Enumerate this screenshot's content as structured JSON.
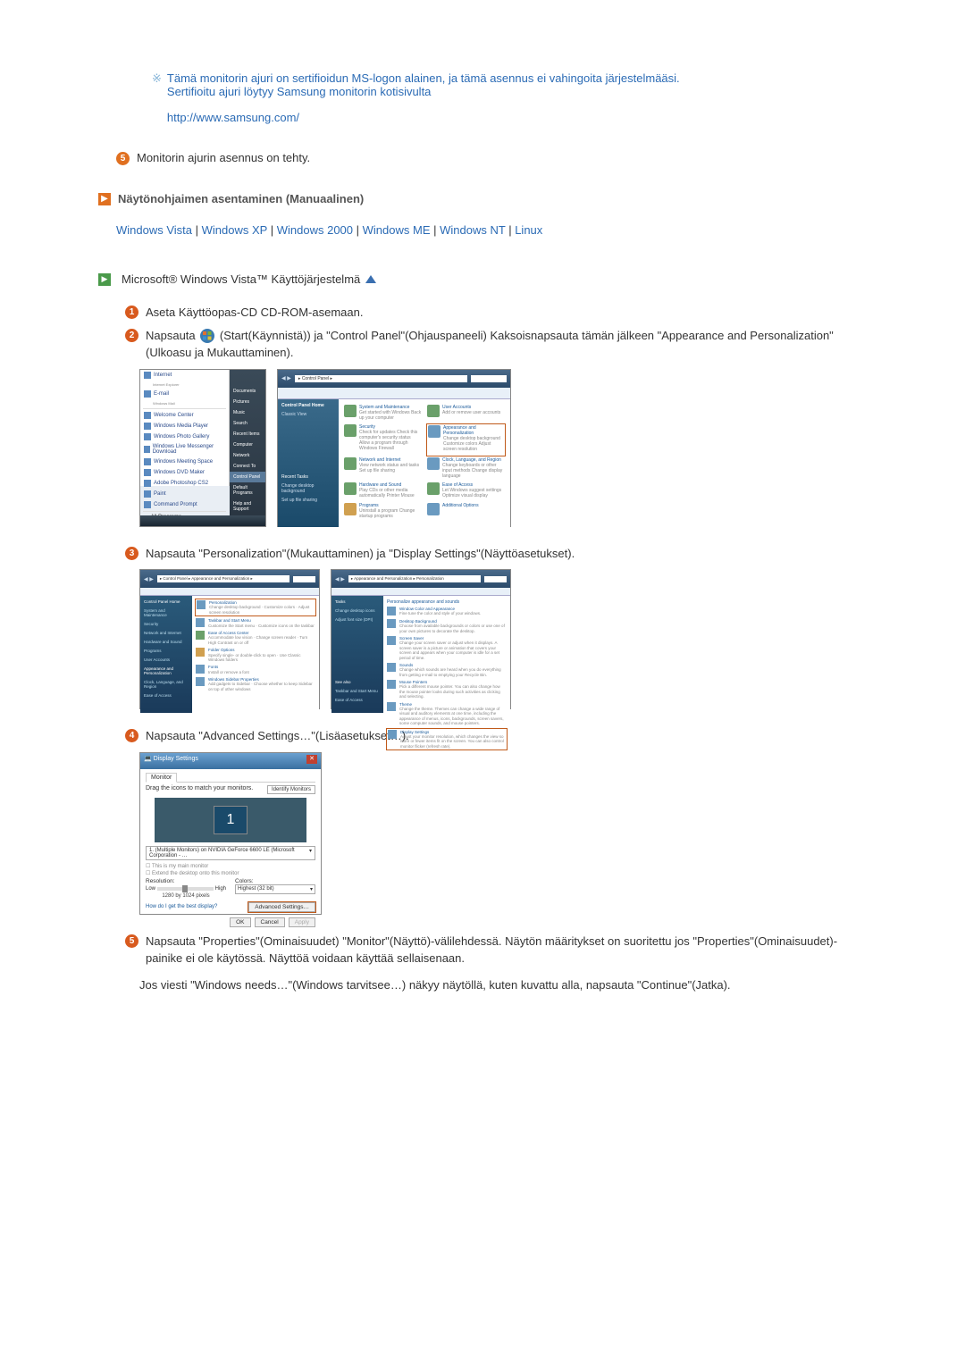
{
  "note": {
    "line1": "Tämä monitorin ajuri on sertifioidun MS-logon alainen, ja tämä asennus ei vahingoita järjestelmääsi.",
    "line2": "Sertifioitu ajuri löytyy Samsung monitorin kotisivulta",
    "url": "http://www.samsung.com/"
  },
  "step5": "Monitorin ajurin asennus on tehty.",
  "section_title": "Näytönohjaimen asentaminen (Manuaalinen)",
  "os_links": {
    "vista": "Windows Vista",
    "xp": "Windows XP",
    "w2000": "Windows 2000",
    "me": "Windows ME",
    "nt": "Windows NT",
    "linux": "Linux"
  },
  "vista_heading": "Microsoft® Windows Vista™ Käyttöjärjestelmä",
  "inst": {
    "s1": "Aseta Käyttöopas-CD CD-ROM-asemaan.",
    "s2a": "Napsauta ",
    "s2b": "(Start(Käynnistä)) ja \"Control Panel\"(Ohjauspaneeli) Kaksoisnapsauta tämän jälkeen \"Appearance and Personalization\"(Ulkoasu ja Mukauttaminen).",
    "s3": "Napsauta \"Personalization\"(Mukauttaminen) ja \"Display Settings\"(Näyttöasetukset).",
    "s4": "Napsauta \"Advanced Settings…\"(Lisäasetukset…).",
    "s5": "Napsauta \"Properties\"(Ominaisuudet) \"Monitor\"(Näyttö)-välilehdessä. Näytön määritykset on suoritettu jos \"Properties\"(Ominaisuudet)-painike ei ole käytössä. Näyttöä voidaan käyttää sellaisenaan.",
    "s5b": "Jos viesti \"Windows needs…\"(Windows tarvitsee…) näkyy näytöllä, kuten kuvattu alla, napsauta \"Continue\"(Jatka)."
  },
  "start_menu": {
    "items": [
      "Internet",
      "E-mail",
      "Welcome Center",
      "Windows Media Player",
      "Windows Photo Gallery",
      "Windows Live Messenger Download",
      "Windows Meeting Space",
      "Windows DVD Maker",
      "Adobe Photoshop CS2",
      "Paint",
      "Command Prompt"
    ],
    "all_programs": "All Programs",
    "right": [
      "Documents",
      "Pictures",
      "Music",
      "Search",
      "Recent Items",
      "Computer",
      "Network",
      "Connect To",
      "Control Panel",
      "Default Programs",
      "Help and Support"
    ]
  },
  "control_panel": {
    "title": "Control Panel",
    "side_title": "Control Panel Home",
    "side_link": "Classic View",
    "cats": [
      {
        "t": "System and Maintenance",
        "s": "Get started with Windows\nBack up your computer"
      },
      {
        "t": "User Accounts",
        "s": "Add or remove user accounts"
      },
      {
        "t": "Security",
        "s": "Check for updates\nCheck this computer's security status\nAllow a program through Windows Firewall"
      },
      {
        "t": "Appearance and Personalization",
        "s": "Change desktop background\nCustomize colors\nAdjust screen resolution"
      },
      {
        "t": "Network and Internet",
        "s": "View network status and tasks\nSet up file sharing"
      },
      {
        "t": "Clock, Language, and Region",
        "s": "Change keyboards or other input methods\nChange display language"
      },
      {
        "t": "Hardware and Sound",
        "s": "Play CDs or other media automatically\nPrinter\nMouse"
      },
      {
        "t": "Ease of Access",
        "s": "Let Windows suggest settings\nOptimize visual display"
      },
      {
        "t": "Programs",
        "s": "Uninstall a program\nChange startup programs"
      },
      {
        "t": "Additional Options",
        "s": ""
      }
    ],
    "side_recent": "Recent Tasks",
    "side_recent_items": [
      "Change desktop background",
      "Set up file sharing"
    ]
  },
  "appearance_panel": {
    "breadcrumb": "Appearance and Personalization",
    "side": [
      "Control Panel Home",
      "System and Maintenance",
      "Security",
      "Network and Internet",
      "Hardware and Sound",
      "Programs",
      "User Accounts",
      "Appearance and Personalization",
      "Clock, Language, and Region",
      "Ease of Access"
    ],
    "items": [
      {
        "t": "Personalization",
        "s": "Change desktop background · Customize colors · Adjust screen resolution"
      },
      {
        "t": "Taskbar and Start Menu",
        "s": "Customize the Start menu · Customize icons on the taskbar"
      },
      {
        "t": "Ease of Access Center",
        "s": "Accommodate low vision · Change screen reader · Turn High Contrast on or off"
      },
      {
        "t": "Folder Options",
        "s": "Specify single- or double-click to open · Use Classic Windows folders"
      },
      {
        "t": "Fonts",
        "s": "Install or remove a font"
      },
      {
        "t": "Windows Sidebar Properties",
        "s": "Add gadgets to Sidebar · Choose whether to keep Sidebar on top of other windows"
      }
    ]
  },
  "personalize_panel": {
    "breadcrumb": "Personalization",
    "side": [
      "Tasks",
      "Change desktop icons",
      "Adjust font size (DPI)"
    ],
    "heading": "Personalize appearance and sounds",
    "items": [
      {
        "t": "Window Color and Appearance",
        "s": "Fine tune the color and style of your windows."
      },
      {
        "t": "Desktop Background",
        "s": "Choose from available backgrounds or colors or use one of your own pictures to decorate the desktop."
      },
      {
        "t": "Screen Saver",
        "s": "Change your screen saver or adjust when it displays. A screen saver is a picture or animation that covers your screen and appears when your computer is idle for a set period of time."
      },
      {
        "t": "Sounds",
        "s": "Change which sounds are heard when you do everything from getting e-mail to emptying your Recycle Bin."
      },
      {
        "t": "Mouse Pointers",
        "s": "Pick a different mouse pointer. You can also change how the mouse pointer looks during such activities as clicking and selecting."
      },
      {
        "t": "Theme",
        "s": "Change the theme. Themes can change a wide range of visual and auditory elements at one time, including the appearance of menus, icons, backgrounds, screen savers, some computer sounds, and mouse pointers."
      },
      {
        "t": "Display Settings",
        "s": "Adjust your monitor resolution, which changes the view so more or fewer items fit on the screen. You can also control monitor flicker (refresh rate)."
      }
    ],
    "see_also": "See also",
    "see_items": [
      "Taskbar and Start Menu",
      "Ease of Access"
    ]
  },
  "display_settings": {
    "title": "Display Settings",
    "tab": "Monitor",
    "drag_text": "Drag the icons to match your monitors.",
    "identify": "Identify Monitors",
    "monitor_num": "1",
    "dropdown": "1. (Multiple Monitors) on NVIDIA GeForce 6600 LE (Microsoft Corporation - …",
    "check1": "This is my main monitor",
    "check2": "Extend the desktop onto this monitor",
    "resolution_label": "Resolution:",
    "low": "Low",
    "high": "High",
    "res_value": "1280 by 1024 pixels",
    "colors_label": "Colors:",
    "colors_value": "Highest (32 bit)",
    "help_link": "How do I get the best display?",
    "advanced": "Advanced Settings…",
    "ok": "OK",
    "cancel": "Cancel",
    "apply": "Apply"
  }
}
